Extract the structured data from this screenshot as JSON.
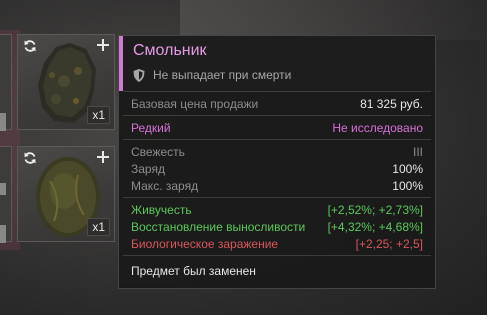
{
  "inventory": {
    "slots": [
      {
        "count": "x1"
      },
      {
        "count": "x1"
      }
    ]
  },
  "tooltip": {
    "title": "Смольник",
    "death_note": "Не выпадает при смерти",
    "price_label": "Базовая цена продажи",
    "price_value": "81 325 руб.",
    "rarity_label": "Редкий",
    "rarity_status": "Не исследовано",
    "stats": [
      {
        "label": "Свежесть",
        "value": "III"
      },
      {
        "label": "Заряд",
        "value": "100%"
      },
      {
        "label": "Макс. заряд",
        "value": "100%"
      }
    ],
    "effects": [
      {
        "label": "Живучесть",
        "value": "[+2,52%; +2,73%]",
        "color": "#5cc85c"
      },
      {
        "label": "Восстановление выносливости",
        "value": "[+4,32%; +4,68%]",
        "color": "#5cc85c"
      },
      {
        "label": "Биологическое заражение",
        "value": "[+2,25; +2,5]",
        "color": "#d8565a"
      }
    ],
    "note": "Предмет был заменен"
  },
  "colors": {
    "accent": "#d07ad6",
    "title": "#e59ae6",
    "positive": "#5cc85c",
    "negative": "#d8565a"
  }
}
